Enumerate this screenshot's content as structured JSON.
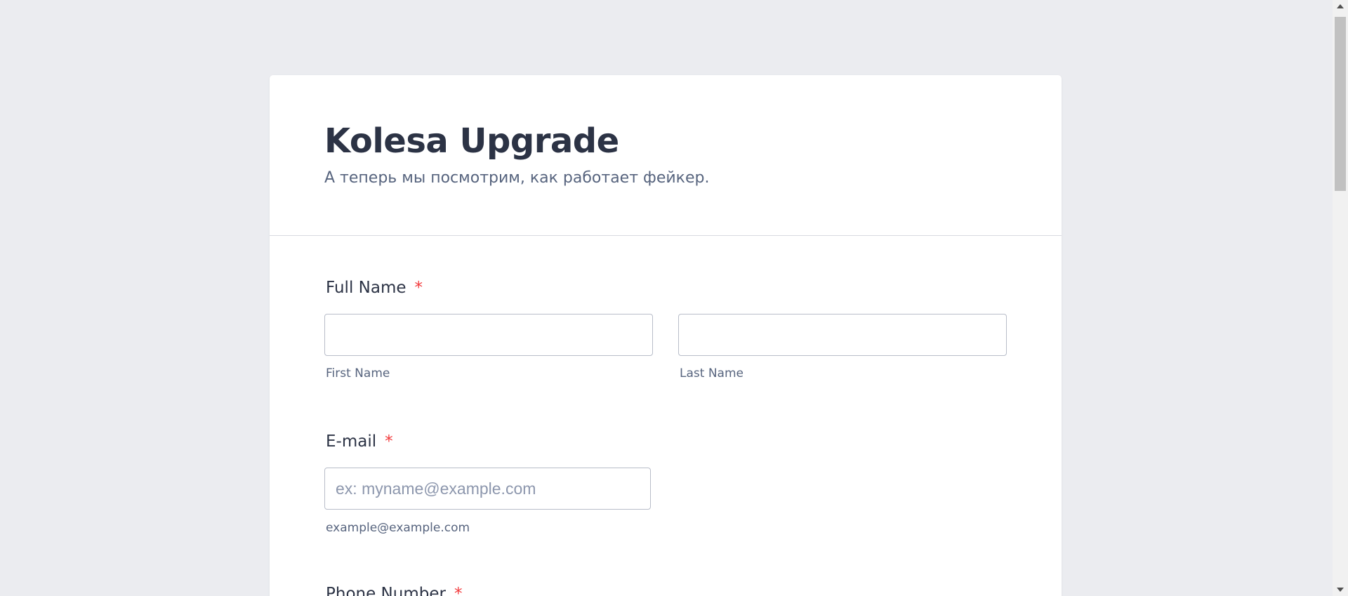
{
  "form": {
    "title": "Kolesa Upgrade",
    "subtitle": "А теперь мы посмотрим, как работает фейкер.",
    "full_name": {
      "label": "Full Name",
      "required_marker": "*",
      "first_name_value": "",
      "first_name_sublabel": "First Name",
      "last_name_value": "",
      "last_name_sublabel": "Last Name"
    },
    "email": {
      "label": "E-mail",
      "required_marker": "*",
      "value": "",
      "placeholder": "ex: myname@example.com",
      "sublabel": "example@example.com"
    },
    "phone": {
      "label": "Phone Number",
      "required_marker": "*"
    }
  },
  "colors": {
    "page_background": "#ebecf0",
    "card_background": "#ffffff",
    "title_text": "#2c3345",
    "secondary_text": "#57647e",
    "required_marker": "#f23a3c",
    "input_border": "#b8bdc9",
    "placeholder_text": "#8d97ad"
  }
}
